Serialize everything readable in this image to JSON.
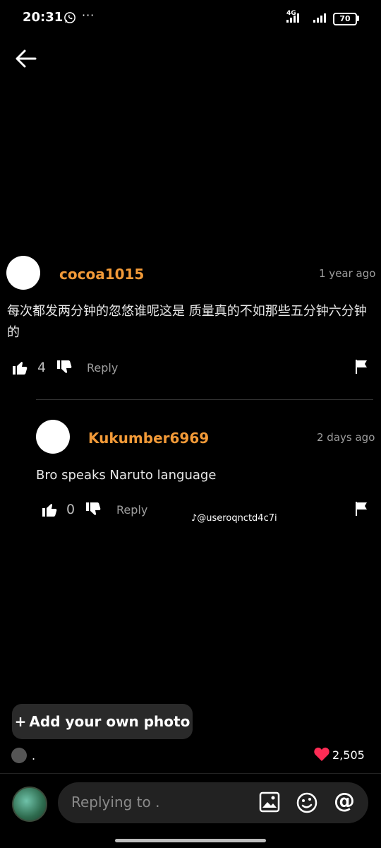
{
  "status_bar": {
    "time": "20:31",
    "network": "4G",
    "battery": "70",
    "icons": [
      "whatsapp-icon",
      "more-dots-icon",
      "signal-icon",
      "battery-icon"
    ]
  },
  "header": {
    "back_icon": "arrow-left-icon"
  },
  "comments": [
    {
      "username": "cocoa1015",
      "time": "1 year ago",
      "text": "每次都发两分钟的忽悠谁呢这是 质量真的不如那些五分钟六分钟的",
      "likes": "4",
      "reply_label": "Reply"
    },
    {
      "username": "Kukumber6969",
      "time": "2 days ago",
      "text": "Bro speaks Naruto language",
      "likes": "0",
      "reply_label": "Reply"
    }
  ],
  "watermark": "@useroqnctd4c7i",
  "add_photo": {
    "plus": "+",
    "label": "Add your own photo"
  },
  "footer": {
    "dot": ".",
    "likes": "2,505",
    "heart_color": "#fe2c55"
  },
  "composer": {
    "placeholder": "Replying to .",
    "icons": [
      "image-icon",
      "emoji-icon",
      "mention-icon"
    ]
  },
  "colors": {
    "username": "#f29a38",
    "background": "#000000"
  }
}
